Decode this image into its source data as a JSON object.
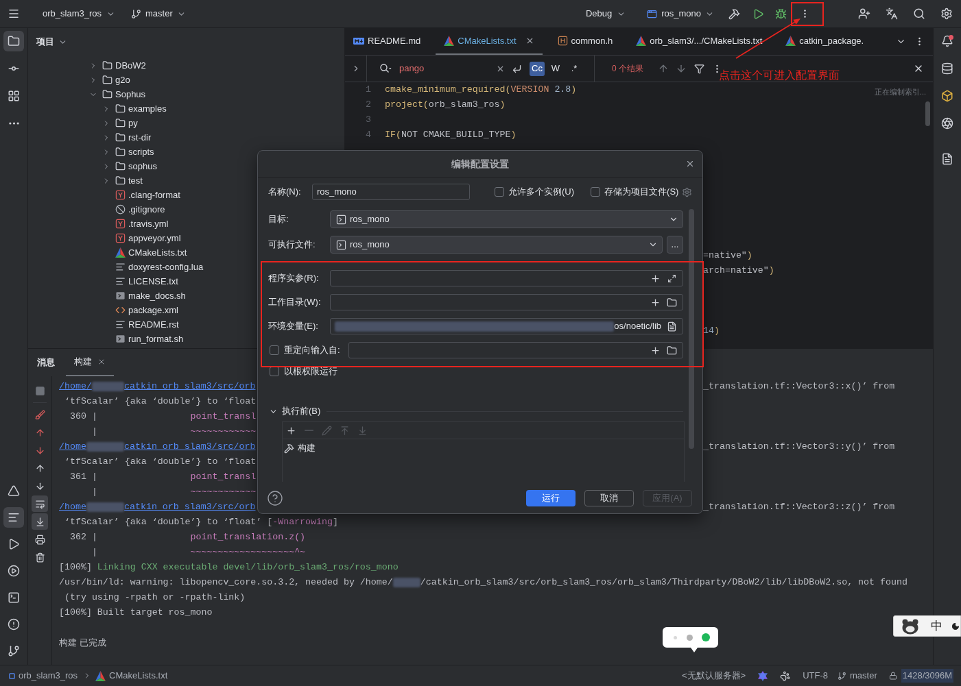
{
  "main_toolbar": {
    "project": "orb_slam3_ros",
    "branch": "master",
    "build_config": "Debug",
    "run_config": "ros_mono"
  },
  "left_tool_strip": {
    "top": [
      {
        "kind": "project",
        "selected": true
      },
      {
        "kind": "commit",
        "selected": false
      },
      {
        "kind": "structure",
        "selected": false
      },
      {
        "kind": "more",
        "selected": false
      }
    ],
    "bottom": [
      {
        "kind": "cmake",
        "selected": false
      },
      {
        "kind": "build",
        "selected": true
      },
      {
        "kind": "run",
        "selected": false
      },
      {
        "kind": "services",
        "selected": false
      },
      {
        "kind": "terminal",
        "selected": false
      },
      {
        "kind": "problems",
        "selected": false
      },
      {
        "kind": "git",
        "selected": false
      }
    ]
  },
  "project_panel": {
    "title": "项目",
    "tree": [
      {
        "name": "DBoW2",
        "kind": "folder",
        "expanded": false
      },
      {
        "name": "g2o",
        "kind": "folder",
        "expanded": false
      },
      {
        "name": "Sophus",
        "kind": "folder",
        "expanded": true,
        "children": [
          {
            "name": "examples",
            "kind": "folder",
            "expanded": false
          },
          {
            "name": "py",
            "kind": "folder",
            "expanded": false
          },
          {
            "name": "rst-dir",
            "kind": "folder",
            "expanded": false
          },
          {
            "name": "scripts",
            "kind": "folder",
            "expanded": false
          },
          {
            "name": "sophus",
            "kind": "folder",
            "expanded": false
          },
          {
            "name": "test",
            "kind": "folder",
            "expanded": false
          },
          {
            "name": ".clang-format",
            "kind": "yaml"
          },
          {
            "name": ".gitignore",
            "kind": "ignore"
          },
          {
            "name": ".travis.yml",
            "kind": "yaml"
          },
          {
            "name": "appveyor.yml",
            "kind": "yaml"
          },
          {
            "name": "CMakeLists.txt",
            "kind": "cmake"
          },
          {
            "name": "doxyrest-config.lua",
            "kind": "text"
          },
          {
            "name": "LICENSE.txt",
            "kind": "text"
          },
          {
            "name": "make_docs.sh",
            "kind": "shell"
          },
          {
            "name": "package.xml",
            "kind": "xml"
          },
          {
            "name": "README.rst",
            "kind": "text"
          },
          {
            "name": "run_format.sh",
            "kind": "shell"
          }
        ]
      }
    ]
  },
  "editor": {
    "tabs": [
      {
        "label": "README.md",
        "kind": "markdown",
        "selected": false,
        "modified": false
      },
      {
        "label": "CMakeLists.txt",
        "kind": "cmake",
        "selected": true,
        "modified": true
      },
      {
        "label": "common.h",
        "kind": "header",
        "selected": false,
        "modified": false
      },
      {
        "label": "orb_slam3/.../CMakeLists.txt",
        "kind": "cmake",
        "selected": false,
        "modified": false
      },
      {
        "label": "catkin_package.",
        "kind": "cmake",
        "selected": false,
        "modified": false
      }
    ],
    "search": {
      "query": "pango",
      "result": "0 个结果",
      "options": [
        {
          "label": "Cc",
          "selected": true
        },
        {
          "label": "W",
          "selected": false
        },
        {
          "label": ".*",
          "selected": false
        }
      ]
    },
    "indexing_status": "正在编制索引...",
    "lines": [
      {
        "number": "1",
        "tokens": [
          {
            "text": "cmake_minimum_required",
            "kind": "command"
          },
          {
            "text": "(",
            "kind": "paren"
          },
          {
            "text": "VERSION",
            "kind": "keyword"
          },
          {
            "text": " 2.8",
            "kind": "number"
          },
          {
            "text": ")",
            "kind": "paren"
          }
        ]
      },
      {
        "number": "2",
        "tokens": [
          {
            "text": "project",
            "kind": "command"
          },
          {
            "text": "(",
            "kind": "paren"
          },
          {
            "text": "orb_slam3_ros",
            "kind": "plain"
          },
          {
            "text": ")",
            "kind": "paren"
          }
        ]
      },
      {
        "number": "3"
      },
      {
        "number": "4",
        "tokens": [
          {
            "text": "IF",
            "kind": "command"
          },
          {
            "text": "(",
            "kind": "paren"
          },
          {
            "text": "NOT CMAKE_BUILD_TYPE",
            "kind": "plain"
          },
          {
            "text": ")",
            "kind": "paren"
          }
        ]
      }
    ],
    "covered_line_tails": [
      {
        "tokens": [
          {
            "text": "=native\"",
            "kind": "plain"
          },
          {
            "text": ")",
            "kind": "paren"
          }
        ]
      },
      {
        "tokens": [
          {
            "text": "arch=native\"",
            "kind": "plain"
          },
          {
            "text": ")",
            "kind": "paren"
          }
        ]
      },
      {
        "tokens": [
          {
            "text": "14",
            "kind": "number"
          },
          {
            "text": ")",
            "kind": "paren"
          }
        ]
      }
    ]
  },
  "right_tool_strip": [
    {
      "kind": "notifications",
      "badge": true
    },
    {
      "kind": "database",
      "badge": false
    },
    {
      "kind": "plugin",
      "badge": false
    },
    {
      "kind": "ai",
      "badge": false
    },
    {
      "kind": "assistant",
      "badge": false
    }
  ],
  "build_window": {
    "title": "消息",
    "tabs": [
      {
        "label": "构建",
        "selected": true,
        "closable": true
      }
    ],
    "toolbar": [
      {
        "kind": "stop",
        "selected": false
      },
      {
        "kind": "clear",
        "selected": false
      },
      {
        "kind": "previous_error",
        "selected": false
      },
      {
        "kind": "next_error",
        "selected": false
      },
      {
        "kind": "previous",
        "selected": false
      },
      {
        "kind": "next",
        "selected": false
      },
      {
        "kind": "soft_wrap",
        "selected": true
      },
      {
        "kind": "scroll_to_end",
        "selected": true
      },
      {
        "kind": "print",
        "selected": false
      },
      {
        "kind": "delete",
        "selected": false
      }
    ],
    "output": [
      {
        "kind": "link",
        "before": "/home/",
        "after": "catkin_orb_slam3/src/orb",
        "tail": "_translation.tf::Vector3::x()’ from"
      },
      {
        "kind": "text",
        "segments": [
          {
            "text": " ‘tfScalar’ {aka ‘double’} to ‘float",
            "kind": "plain"
          }
        ]
      },
      {
        "kind": "text",
        "segments": [
          {
            "text": "  360 |",
            "kind": "plain"
          },
          {
            "text": "                 point_transl",
            "kind": "code"
          }
        ]
      },
      {
        "kind": "text",
        "segments": [
          {
            "text": "      |",
            "kind": "plain"
          },
          {
            "text": "                 ~~~~~~~~~~~~",
            "kind": "code"
          }
        ]
      },
      {
        "kind": "link",
        "before": "/home",
        "after": "catkin_orb_slam3/src/orb",
        "tail": "_translation.tf::Vector3::y()’ from"
      },
      {
        "kind": "text",
        "segments": [
          {
            "text": " ‘tfScalar’ {aka ‘double’} to ‘float",
            "kind": "plain"
          }
        ]
      },
      {
        "kind": "text",
        "segments": [
          {
            "text": "  361 |",
            "kind": "plain"
          },
          {
            "text": "                 point_transl",
            "kind": "code"
          }
        ]
      },
      {
        "kind": "text",
        "segments": [
          {
            "text": "      |",
            "kind": "plain"
          },
          {
            "text": "                 ~~~~~~~~~~~~",
            "kind": "code"
          }
        ]
      },
      {
        "kind": "link",
        "before": "/home",
        "after": "catkin_orb_slam3/src/orb",
        "tail": "_translation.tf::Vector3::z()’ from"
      },
      {
        "kind": "text",
        "segments": [
          {
            "text": " ‘tfScalar’ {aka ‘double’} to ‘float’ [",
            "kind": "plain"
          },
          {
            "text": "-Wnarrowing",
            "kind": "code"
          },
          {
            "text": "]",
            "kind": "plain"
          }
        ]
      },
      {
        "kind": "text",
        "segments": [
          {
            "text": "  362 |",
            "kind": "plain"
          },
          {
            "text": "                 point_translation.z()",
            "kind": "code"
          }
        ]
      },
      {
        "kind": "text",
        "segments": [
          {
            "text": "      |",
            "kind": "plain"
          },
          {
            "text": "                 ~~~~~~~~~~~~~~~~~~~^~",
            "kind": "code"
          }
        ]
      },
      {
        "kind": "text",
        "segments": [
          {
            "text": "[100%] ",
            "kind": "plain"
          },
          {
            "text": "Linking CXX executable devel/lib/orb_slam3_ros/ros_mono",
            "kind": "success"
          }
        ]
      },
      {
        "kind": "text",
        "segments": [
          {
            "text": "/usr/bin/ld: warning: libopencv_core.so.3.2, needed by /home/",
            "kind": "plain"
          },
          {
            "kind": "redacted"
          },
          {
            "text": "/catkin_orb_slam3/src/orb_slam3_ros/orb_slam3/Thirdparty/DBoW2/lib/libDBoW2.so, not found",
            "kind": "plain"
          }
        ]
      },
      {
        "kind": "text",
        "segments": [
          {
            "text": " (try using -rpath or -rpath-link)",
            "kind": "plain"
          }
        ]
      },
      {
        "kind": "text",
        "segments": [
          {
            "text": "[100%] Built target ros_mono",
            "kind": "plain"
          }
        ]
      }
    ],
    "status": "构建 已完成"
  },
  "run_config_dialog": {
    "title": "编辑配置设置",
    "name": {
      "label": "名称(N):",
      "value": "ros_mono"
    },
    "options": [
      {
        "label": "允许多个实例(U)",
        "checked": false
      },
      {
        "label": "存储为项目文件(S)",
        "checked": false
      }
    ],
    "target": {
      "label": "目标:",
      "value": "ros_mono"
    },
    "executable": {
      "label": "可执行文件:",
      "value": "ros_mono",
      "browse": "..."
    },
    "fields": [
      {
        "label": "程序实参(R):",
        "kind": "arguments"
      },
      {
        "label": "工作目录(W):",
        "kind": "directory"
      },
      {
        "label": "环境变量(E):",
        "kind": "environment",
        "value": "os/noetic/lib"
      }
    ],
    "redirect_input": {
      "label": "重定向输入自:",
      "checked": false
    },
    "run_as_root": {
      "label": "以根权限运行",
      "checked": false
    },
    "before_launch": {
      "title": "执行前(B)",
      "expanded": true,
      "toolbar": [
        {
          "kind": "add",
          "disabled": false
        },
        {
          "kind": "remove",
          "disabled": true
        },
        {
          "kind": "edit",
          "disabled": true
        },
        {
          "kind": "move_up",
          "disabled": true
        },
        {
          "kind": "move_down",
          "disabled": true
        }
      ],
      "tasks": [
        {
          "label": "构建"
        }
      ]
    },
    "buttons": [
      {
        "label": "运行",
        "kind": "primary",
        "disabled": false
      },
      {
        "label": "取消",
        "kind": "secondary",
        "disabled": false
      },
      {
        "label": "应用(A)",
        "kind": "secondary",
        "disabled": true
      }
    ]
  },
  "annotation": {
    "text": "点击这个可进入配置界面"
  },
  "status_bar": {
    "breadcrumbs": [
      {
        "label": "orb_slam3_ros",
        "kind": "module"
      },
      {
        "label": "CMakeLists.txt",
        "kind": "cmake"
      }
    ],
    "server": "<无默认服务器>",
    "encoding": "UTF-8",
    "branch": "master",
    "memory": "1428/3096M"
  },
  "recorder_popup": {
    "dots": [
      {
        "color": "#d9d9d9"
      },
      {
        "color": "#b3b3b3"
      },
      {
        "color": "#1fb85a"
      }
    ]
  },
  "ime_bar": {
    "mode": "中"
  }
}
